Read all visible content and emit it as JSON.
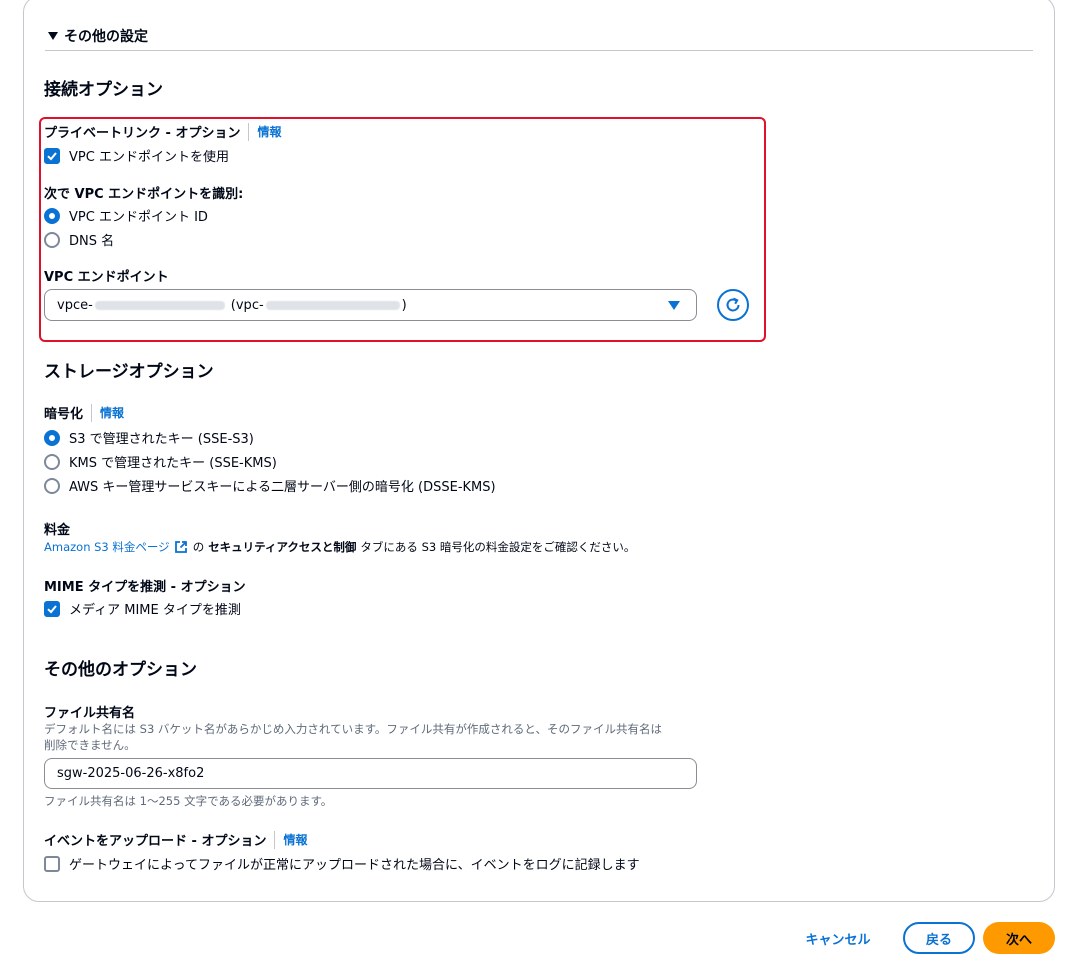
{
  "section": {
    "title": "その他の設定"
  },
  "connection": {
    "heading": "接続オプション",
    "privatelink": {
      "label": "プライベートリンク - オプション",
      "info": "情報",
      "checkbox_label": "VPC エンドポイントを使用",
      "checked": true
    },
    "identify": {
      "label": "次で VPC エンドポイントを識別:",
      "options": [
        {
          "label": "VPC エンドポイント ID",
          "selected": true
        },
        {
          "label": "DNS 名",
          "selected": false
        }
      ]
    },
    "endpoint": {
      "label": "VPC エンドポイント",
      "value_prefix": "vpce-",
      "value_middle": "(vpc-",
      "value_suffix": ")"
    }
  },
  "storage": {
    "heading": "ストレージオプション",
    "encryption": {
      "label": "暗号化",
      "info": "情報",
      "options": [
        {
          "label": "S3 で管理されたキー (SSE-S3)",
          "selected": true
        },
        {
          "label": "KMS で管理されたキー (SSE-KMS)",
          "selected": false
        },
        {
          "label": "AWS キー管理サービスキーによる二層サーバー側の暗号化 (DSSE-KMS)",
          "selected": false
        }
      ]
    },
    "pricing": {
      "label": "料金",
      "link": "Amazon S3 料金ページ",
      "text_1": "の",
      "bold": "セキュリティアクセスと制御",
      "text_2": "タブにある S3 暗号化の料金設定をご確認ください。"
    },
    "mime": {
      "label": "MIME タイプを推測 - オプション",
      "checkbox_label": "メディア MIME タイプを推測",
      "checked": true
    }
  },
  "other": {
    "heading": "その他のオプション",
    "share_name": {
      "label": "ファイル共有名",
      "desc_1": "デフォルト名には S3 バケット名があらかじめ入力されています。ファイル共有が作成されると、そのファイル共有名は",
      "desc_2": "削除できません。",
      "value": "sgw-2025-06-26-x8fo2",
      "constraint": "ファイル共有名は 1〜255 文字である必要があります。"
    },
    "upload_event": {
      "label": "イベントをアップロード - オプション",
      "info": "情報",
      "checkbox_label": "ゲートウェイによってファイルが正常にアップロードされた場合に、イベントをログに記録します",
      "checked": false
    }
  },
  "footer": {
    "cancel": "キャンセル",
    "back": "戻る",
    "next": "次へ"
  },
  "colors": {
    "accent": "#0972d3",
    "highlight": "#e0112a",
    "primary_button": "#ff9900"
  }
}
